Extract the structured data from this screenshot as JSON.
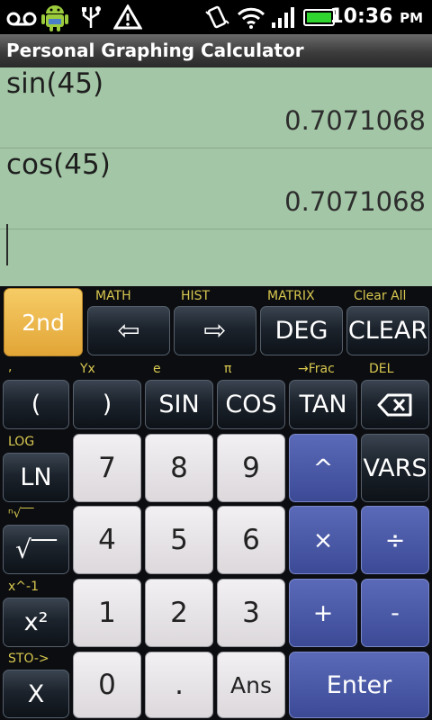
{
  "status_bar": {
    "icons": [
      "voicemail-icon",
      "android-icon",
      "usb-icon",
      "warning-icon",
      "vibrate-icon",
      "wifi-icon",
      "signal-icon",
      "battery-icon"
    ],
    "time": "10:36",
    "ampm": "PM"
  },
  "app": {
    "title": "Personal Graphing Calculator"
  },
  "display": {
    "history": [
      {
        "expression": "sin(45)",
        "result": "0.7071068"
      },
      {
        "expression": "cos(45)",
        "result": "0.7071068"
      }
    ],
    "input": ""
  },
  "keys": {
    "second": "2nd",
    "left": "⇦",
    "right": "⇨",
    "deg": "DEG",
    "clear": "CLEAR",
    "lparen": "(",
    "rparen": ")",
    "sin": "SIN",
    "cos": "COS",
    "tan": "TAN",
    "backspace": "⌫",
    "ln": "LN",
    "seven": "7",
    "eight": "8",
    "nine": "9",
    "power": "^",
    "vars": "VARS",
    "sqrt": "√‾‾",
    "four": "4",
    "five": "5",
    "six": "6",
    "multiply": "×",
    "divide": "÷",
    "square": "x²",
    "one": "1",
    "two": "2",
    "three": "3",
    "plus": "+",
    "minus": "-",
    "x": "X",
    "zero": "0",
    "dot": ".",
    "ans": "Ans",
    "enter": "Enter"
  },
  "second_labels": {
    "math": "MATH",
    "hist": "HIST",
    "matrix": "MATRIX",
    "clear_all": "Clear All",
    "comma": ",",
    "yx": "Yx",
    "e": "e",
    "pi": "π",
    "frac": "→Frac",
    "del": "DEL",
    "log": "LOG",
    "nroot": "ⁿ√‾‾",
    "inverse": "x^-1",
    "sto": "STO->"
  }
}
